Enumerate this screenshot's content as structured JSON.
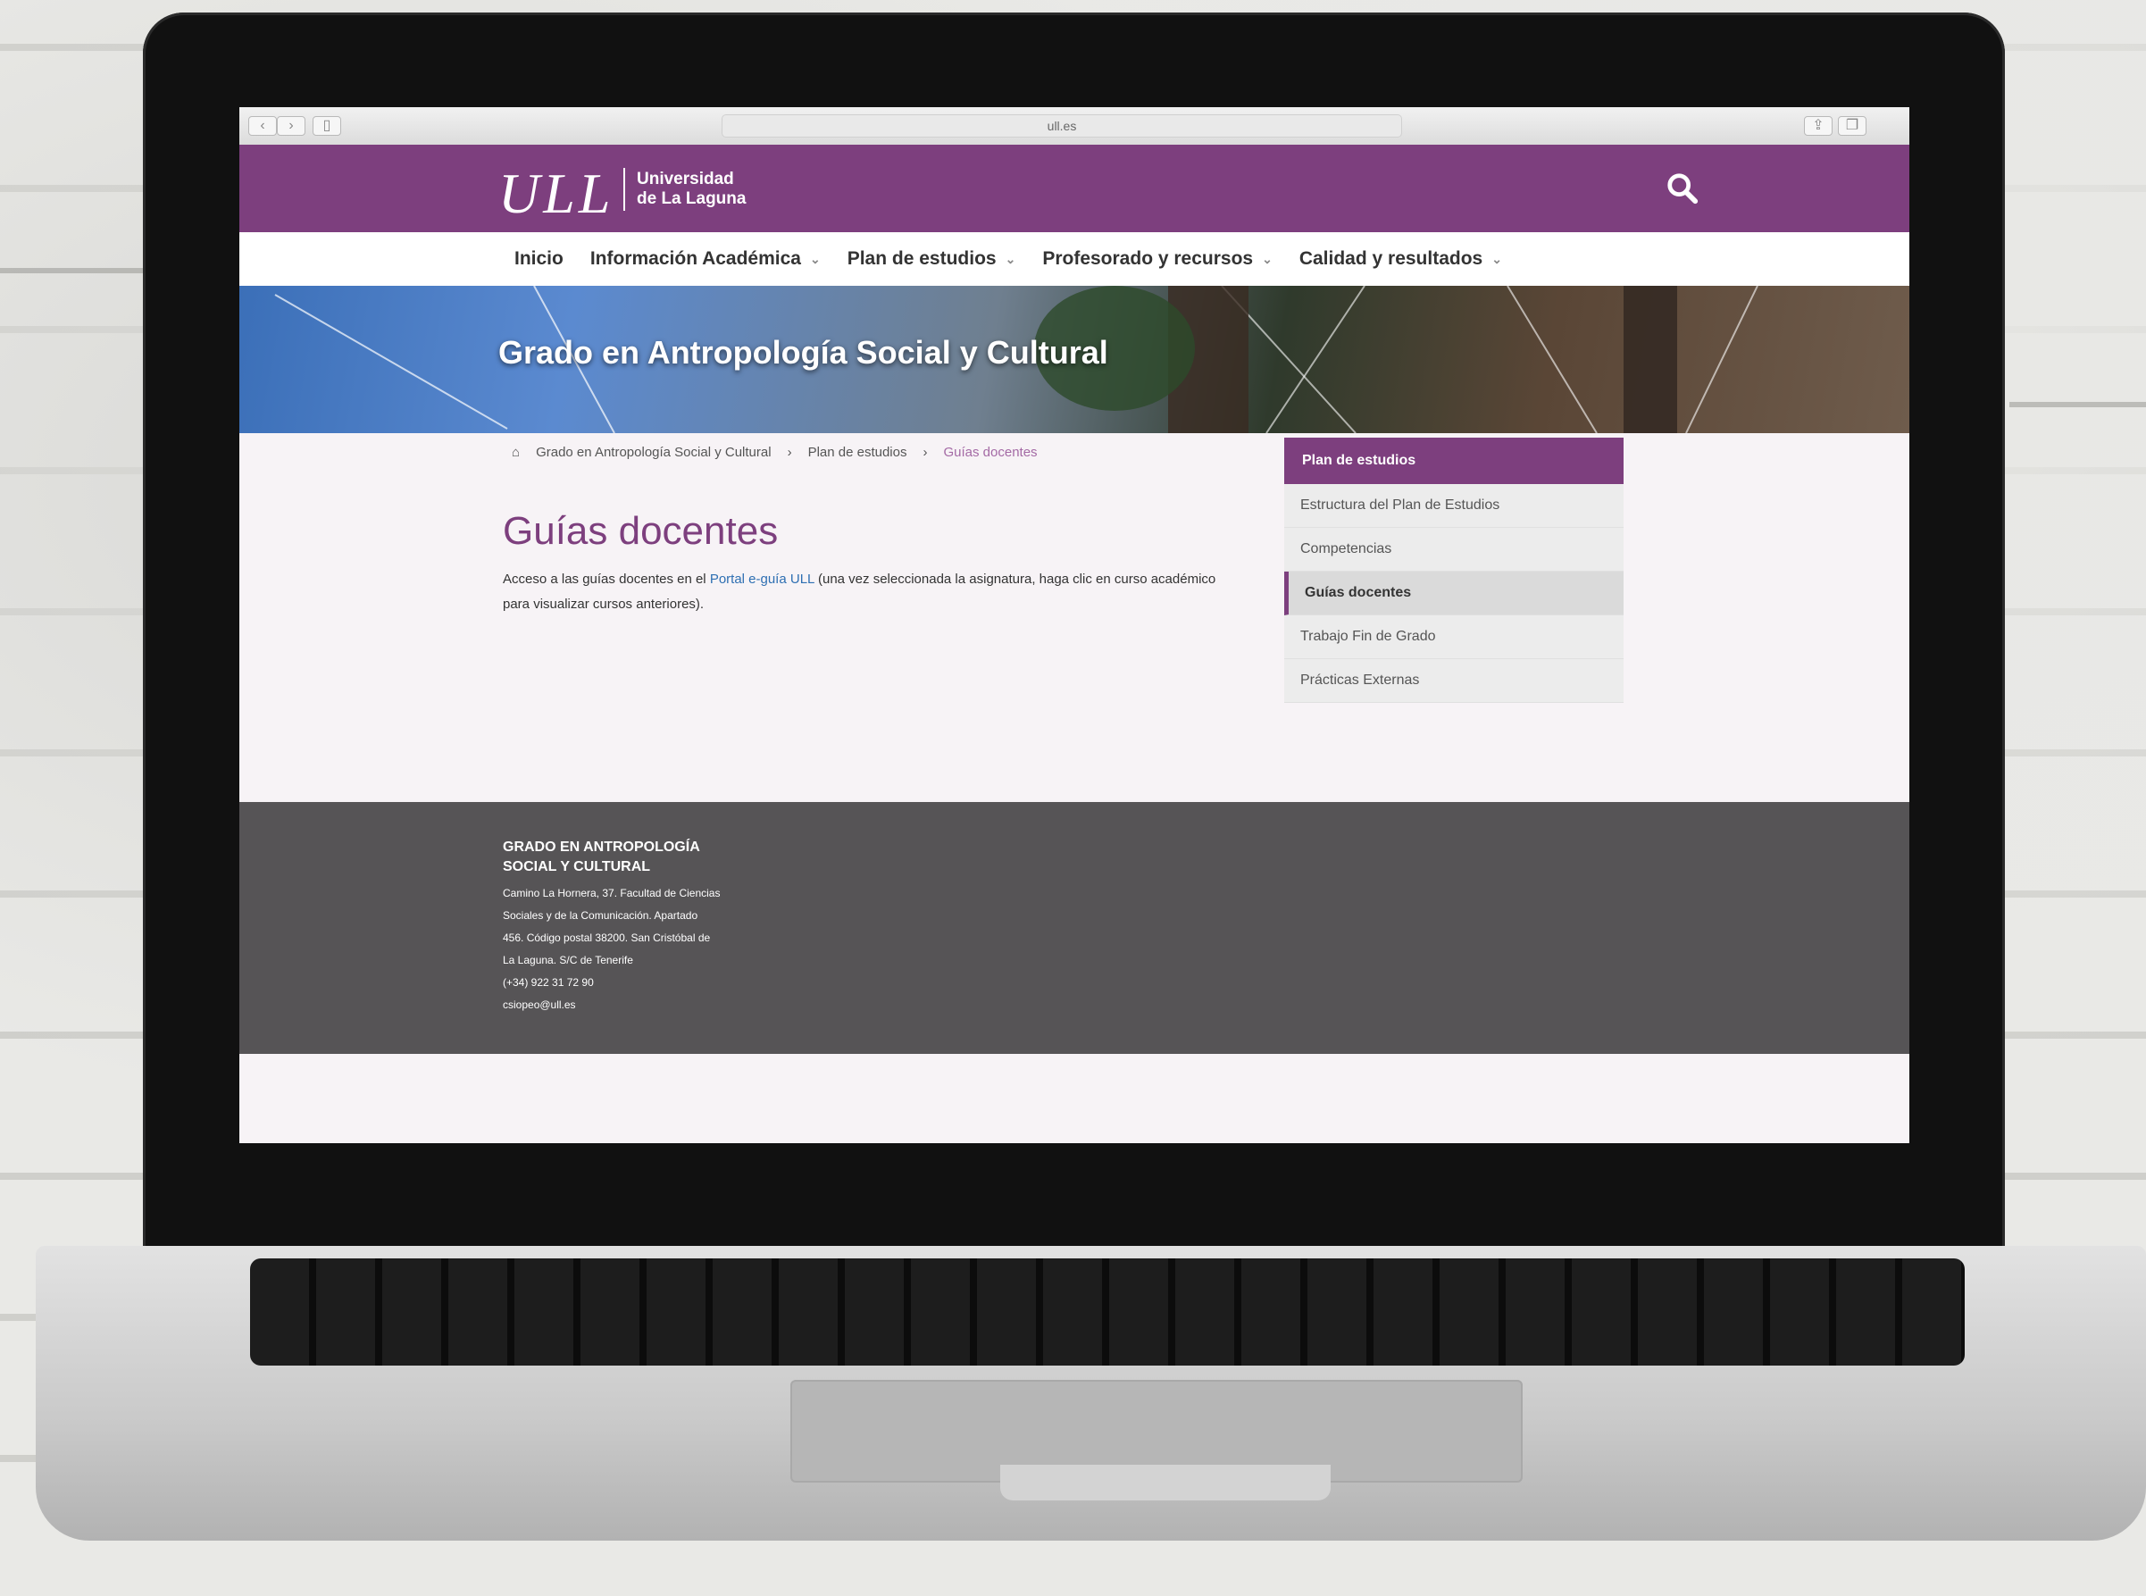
{
  "browser": {
    "url": "ull.es"
  },
  "site": {
    "logo": "ULL",
    "logo_sub_line1": "Universidad",
    "logo_sub_line2": "de La Laguna"
  },
  "nav": {
    "items": [
      {
        "label": "Inicio",
        "dropdown": false
      },
      {
        "label": "Información Académica",
        "dropdown": true
      },
      {
        "label": "Plan de estudios",
        "dropdown": true
      },
      {
        "label": "Profesorado y recursos",
        "dropdown": true
      },
      {
        "label": "Calidad y resultados",
        "dropdown": true
      }
    ]
  },
  "hero": {
    "title": "Grado en Antropología Social y Cultural"
  },
  "breadcrumb": {
    "items": [
      "Grado en Antropología Social y Cultural",
      "Plan de estudios",
      "Guías docentes"
    ]
  },
  "main": {
    "title": "Guías docentes",
    "intro_before": "Acceso a las guías docentes en el ",
    "intro_link": "Portal e-guía ULL",
    "intro_after": " (una vez seleccionada la asignatura, haga clic en curso académico para visualizar cursos anteriores)."
  },
  "sidemenu": {
    "heading": "Plan de estudios",
    "items": [
      {
        "label": "Estructura del Plan de Estudios",
        "active": false
      },
      {
        "label": "Competencias",
        "active": false
      },
      {
        "label": "Guías docentes",
        "active": true
      },
      {
        "label": "Trabajo Fin de Grado",
        "active": false
      },
      {
        "label": "Prácticas Externas",
        "active": false
      }
    ]
  },
  "footer": {
    "title_line1": "GRADO EN ANTROPOLOGÍA",
    "title_line2": "SOCIAL Y CULTURAL",
    "address_line1": "Camino La Hornera, 37. Facultad de Ciencias",
    "address_line2": "Sociales y de la Comunicación. Apartado",
    "address_line3": "456. Código postal 38200. San Cristóbal de",
    "address_line4": "La Laguna. S/C de Tenerife",
    "phone": "(+34) 922 31 72 90",
    "email": "csiopeo@ull.es"
  },
  "colors": {
    "brand": "#7d3f7e",
    "footer": "#565456"
  }
}
